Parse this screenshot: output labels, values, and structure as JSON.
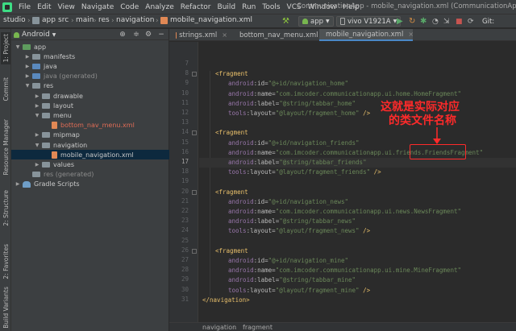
{
  "menubar": {
    "items": [
      "File",
      "Edit",
      "View",
      "Navigate",
      "Code",
      "Analyze",
      "Refactor",
      "Build",
      "Run",
      "Tools",
      "VCS",
      "Window",
      "Help"
    ],
    "window_title": "CommunicationApp - mobile_navigation.xml (CommunicationApp.app)"
  },
  "navbar": {
    "crumbs": [
      "studio",
      "app",
      "src",
      "main",
      "res",
      "navigation",
      "mobile_navigation.xml"
    ],
    "run_config": "app",
    "device": "vivo V1921A",
    "git_label": "Git:"
  },
  "left_stripe": {
    "tabs": [
      "1: Project",
      "Commit",
      "Resource Manager",
      "2: Structure",
      "2: Favorites",
      "Build Variants"
    ]
  },
  "project": {
    "view_label": "Android",
    "tree": [
      {
        "label": "app",
        "kind": "module",
        "style": "normal"
      },
      {
        "label": "manifests",
        "kind": "folder",
        "style": "normal"
      },
      {
        "label": "java",
        "kind": "folder-blue",
        "style": "normal"
      },
      {
        "label": "java (generated)",
        "kind": "folder-blue",
        "style": "dim"
      },
      {
        "label": "res",
        "kind": "folder",
        "style": "normal"
      },
      {
        "label": "drawable",
        "kind": "folder",
        "style": "normal"
      },
      {
        "label": "layout",
        "kind": "folder",
        "style": "normal"
      },
      {
        "label": "menu",
        "kind": "folder",
        "style": "normal"
      },
      {
        "label": "bottom_nav_menu.xml",
        "kind": "file",
        "style": "red"
      },
      {
        "label": "mipmap",
        "kind": "folder",
        "style": "normal"
      },
      {
        "label": "navigation",
        "kind": "folder",
        "style": "normal"
      },
      {
        "label": "mobile_navigation.xml",
        "kind": "file",
        "style": "normal"
      },
      {
        "label": "values",
        "kind": "folder",
        "style": "normal"
      },
      {
        "label": "res (generated)",
        "kind": "folder",
        "style": "dim"
      },
      {
        "label": "Gradle Scripts",
        "kind": "gradle",
        "style": "normal"
      }
    ]
  },
  "editor": {
    "tabs": [
      {
        "label": "strings.xml"
      },
      {
        "label": "bottom_nav_menu.xml"
      },
      {
        "label": "mobile_navigation.xml"
      }
    ],
    "lines": [
      {
        "n": "7",
        "indent": 1,
        "parts": []
      },
      {
        "n": "8",
        "indent": 1,
        "parts": [
          {
            "c": "tag",
            "t": "<fragment"
          }
        ]
      },
      {
        "n": "9",
        "indent": 2,
        "parts": [
          {
            "c": "ns",
            "t": "android"
          },
          {
            "c": "attr",
            "t": ":id="
          },
          {
            "c": "val",
            "t": "\"@+id/navigation_home\""
          }
        ]
      },
      {
        "n": "10",
        "indent": 2,
        "parts": [
          {
            "c": "ns",
            "t": "android"
          },
          {
            "c": "attr",
            "t": ":name="
          },
          {
            "c": "val",
            "t": "\"com.imcoder.communicationapp.ui.home.HomeFragment\""
          }
        ]
      },
      {
        "n": "11",
        "indent": 2,
        "parts": [
          {
            "c": "ns",
            "t": "android"
          },
          {
            "c": "attr",
            "t": ":label="
          },
          {
            "c": "val",
            "t": "\"@string/tabbar_home\""
          }
        ]
      },
      {
        "n": "12",
        "indent": 2,
        "parts": [
          {
            "c": "ns",
            "t": "tools"
          },
          {
            "c": "attr",
            "t": ":layout="
          },
          {
            "c": "val",
            "t": "\"@layout/fragment_home\""
          },
          {
            "c": "tag",
            "t": " />"
          }
        ]
      },
      {
        "n": "13",
        "indent": 1,
        "parts": []
      },
      {
        "n": "14",
        "indent": 1,
        "parts": [
          {
            "c": "tag",
            "t": "<fragment"
          }
        ]
      },
      {
        "n": "15",
        "indent": 2,
        "parts": [
          {
            "c": "ns",
            "t": "android"
          },
          {
            "c": "attr",
            "t": ":id="
          },
          {
            "c": "val",
            "t": "\"@+id/navigation_friends\""
          }
        ]
      },
      {
        "n": "16",
        "indent": 2,
        "parts": [
          {
            "c": "ns",
            "t": "android"
          },
          {
            "c": "attr",
            "t": ":name="
          },
          {
            "c": "val",
            "t": "\"com.imcoder.communicationapp.ui.friends.FriendsFragment\""
          }
        ]
      },
      {
        "n": "17",
        "indent": 2,
        "parts": [
          {
            "c": "ns",
            "t": "android"
          },
          {
            "c": "attr",
            "t": ":label="
          },
          {
            "c": "val",
            "t": "\"@string/tabbar_friends\""
          }
        ]
      },
      {
        "n": "18",
        "indent": 2,
        "parts": [
          {
            "c": "ns",
            "t": "tools"
          },
          {
            "c": "attr",
            "t": ":layout="
          },
          {
            "c": "val",
            "t": "\"@layout/fragment_friends\""
          },
          {
            "c": "tag",
            "t": " />"
          }
        ]
      },
      {
        "n": "19",
        "indent": 1,
        "parts": []
      },
      {
        "n": "20",
        "indent": 1,
        "parts": [
          {
            "c": "tag",
            "t": "<fragment"
          }
        ]
      },
      {
        "n": "21",
        "indent": 2,
        "parts": [
          {
            "c": "ns",
            "t": "android"
          },
          {
            "c": "attr",
            "t": ":id="
          },
          {
            "c": "val",
            "t": "\"@+id/navigation_news\""
          }
        ]
      },
      {
        "n": "22",
        "indent": 2,
        "parts": [
          {
            "c": "ns",
            "t": "android"
          },
          {
            "c": "attr",
            "t": ":name="
          },
          {
            "c": "val",
            "t": "\"com.imcoder.communicationapp.ui.news.NewsFragment\""
          }
        ]
      },
      {
        "n": "23",
        "indent": 2,
        "parts": [
          {
            "c": "ns",
            "t": "android"
          },
          {
            "c": "attr",
            "t": ":label="
          },
          {
            "c": "val",
            "t": "\"@string/tabbar_news\""
          }
        ]
      },
      {
        "n": "24",
        "indent": 2,
        "parts": [
          {
            "c": "ns",
            "t": "tools"
          },
          {
            "c": "attr",
            "t": ":layout="
          },
          {
            "c": "val",
            "t": "\"@layout/fragment_news\""
          },
          {
            "c": "tag",
            "t": " />"
          }
        ]
      },
      {
        "n": "25",
        "indent": 1,
        "parts": []
      },
      {
        "n": "26",
        "indent": 1,
        "parts": [
          {
            "c": "tag",
            "t": "<fragment"
          }
        ]
      },
      {
        "n": "27",
        "indent": 2,
        "parts": [
          {
            "c": "ns",
            "t": "android"
          },
          {
            "c": "attr",
            "t": ":id="
          },
          {
            "c": "val",
            "t": "\"@+id/navigation_mine\""
          }
        ]
      },
      {
        "n": "28",
        "indent": 2,
        "parts": [
          {
            "c": "ns",
            "t": "android"
          },
          {
            "c": "attr",
            "t": ":name="
          },
          {
            "c": "val",
            "t": "\"com.imcoder.communicationapp.ui.mine.MineFragment\""
          }
        ]
      },
      {
        "n": "29",
        "indent": 2,
        "parts": [
          {
            "c": "ns",
            "t": "android"
          },
          {
            "c": "attr",
            "t": ":label="
          },
          {
            "c": "val",
            "t": "\"@string/tabbar_mine\""
          }
        ]
      },
      {
        "n": "30",
        "indent": 2,
        "parts": [
          {
            "c": "ns",
            "t": "tools"
          },
          {
            "c": "attr",
            "t": ":layout="
          },
          {
            "c": "val",
            "t": "\"@layout/fragment_mine\""
          },
          {
            "c": "tag",
            "t": " />"
          }
        ]
      },
      {
        "n": "31",
        "indent": 0,
        "parts": [
          {
            "c": "tag",
            "t": "</navigation>"
          }
        ]
      }
    ],
    "current_line": "17"
  },
  "breadcrumb_bottom": [
    "navigation",
    "fragment"
  ],
  "annotation": {
    "line1": "这就是实际对应",
    "line2": "的类文件名称",
    "color": "#ff2a2a"
  },
  "colors": {
    "bg": "#2b2b2b",
    "panel": "#3c3f41",
    "accent": "#4a88c7"
  }
}
